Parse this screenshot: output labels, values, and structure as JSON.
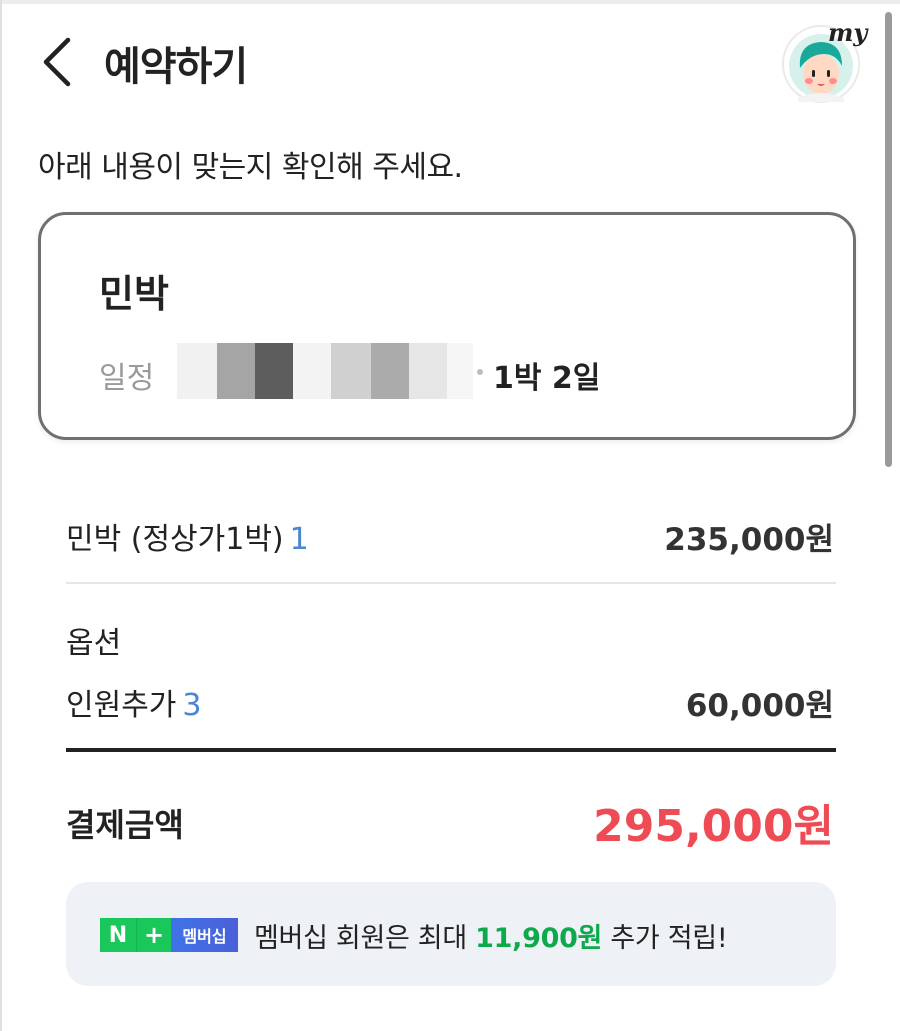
{
  "header": {
    "title": "예약하기",
    "my_label": "my"
  },
  "intro": "아래 내용이 맞는지 확인해 주세요.",
  "booking": {
    "name": "민박",
    "schedule_label": "일정",
    "nights": "1박 2일"
  },
  "items": [
    {
      "label": "민박 (정상가1박)",
      "qty": "1",
      "price": "235,000원"
    }
  ],
  "options": {
    "header": "옵션",
    "items": [
      {
        "label": "인원추가",
        "qty": "3",
        "price": "60,000원"
      }
    ]
  },
  "total": {
    "label": "결제금액",
    "price": "295,000원"
  },
  "membership": {
    "badge_n": "N",
    "badge_plus": "+",
    "badge_label": "멤버십",
    "text_prefix": "멤버십 회원은 최대 ",
    "amount": "11,900원",
    "text_suffix": " 추가 적립!"
  },
  "colors": {
    "accent_blue": "#4a86d1",
    "total_red": "#ef4b55",
    "naver_green": "#19c75a"
  },
  "icons": {
    "back": "chevron-left-icon",
    "my": "avatar-icon"
  }
}
